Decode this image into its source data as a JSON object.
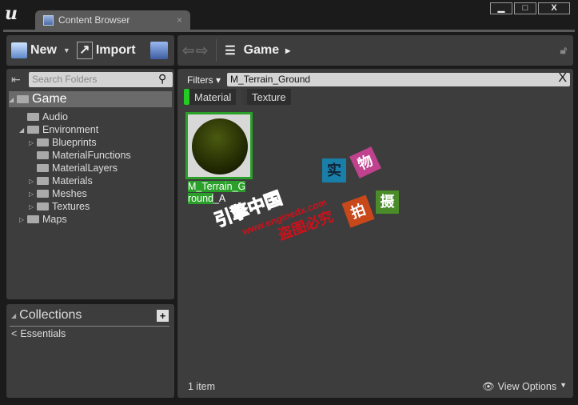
{
  "window": {
    "tab_title": "Content Browser",
    "minimize": "▁",
    "maximize": "□",
    "close": "X"
  },
  "toolbar": {
    "new_label": "New",
    "import_label": "Import"
  },
  "nav": {
    "path": "Game",
    "path_arrow": "▸"
  },
  "sources": {
    "search_placeholder": "Search Folders",
    "items": [
      {
        "label": "Game",
        "depth": 0,
        "expanded": true,
        "selected": true
      },
      {
        "label": "Audio",
        "depth": 1
      },
      {
        "label": "Environment",
        "depth": 1,
        "expanded": true
      },
      {
        "label": "Blueprints",
        "depth": 2,
        "collapsed": true
      },
      {
        "label": "MaterialFunctions",
        "depth": 2
      },
      {
        "label": "MaterialLayers",
        "depth": 2
      },
      {
        "label": "Materials",
        "depth": 2,
        "collapsed": true
      },
      {
        "label": "Meshes",
        "depth": 2,
        "collapsed": true
      },
      {
        "label": "Textures",
        "depth": 2,
        "collapsed": true
      },
      {
        "label": "Maps",
        "depth": 1,
        "collapsed": true
      }
    ]
  },
  "collections": {
    "title": "Collections",
    "add": "+",
    "items": [
      {
        "label": "Essentials"
      }
    ]
  },
  "content": {
    "filters_label": "Filters",
    "search_value": "M_Terrain_Ground",
    "clear": "X",
    "filter_chips": [
      {
        "label": "Material",
        "active": true,
        "color": "#22cc22"
      },
      {
        "label": "Texture",
        "active": false
      }
    ],
    "asset": {
      "name_highlight_1": "M_Terrain_G",
      "name_highlight_2": "round",
      "name_rest": "_A"
    },
    "item_count": "1 item",
    "view_options": "View Options"
  },
  "watermark": {
    "shi": "实",
    "wu": "物",
    "pai": "拍",
    "she": "摄",
    "brand": "引擎中国",
    "url": "www.enginedx.com",
    "notice": "盗图必究"
  }
}
